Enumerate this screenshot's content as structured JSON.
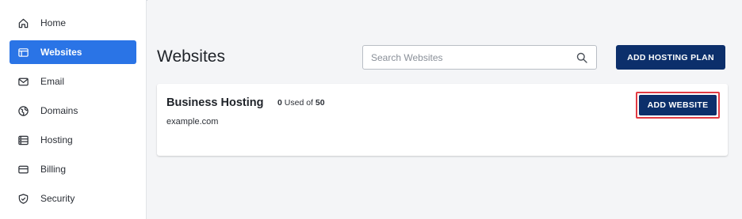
{
  "sidebar": {
    "items": [
      {
        "label": "Home",
        "icon": "home-icon",
        "active": false
      },
      {
        "label": "Websites",
        "icon": "browser-window-icon",
        "active": true
      },
      {
        "label": "Email",
        "icon": "envelope-icon",
        "active": false
      },
      {
        "label": "Domains",
        "icon": "globe-icon",
        "active": false
      },
      {
        "label": "Hosting",
        "icon": "server-icon",
        "active": false
      },
      {
        "label": "Billing",
        "icon": "credit-card-icon",
        "active": false
      },
      {
        "label": "Security",
        "icon": "shield-check-icon",
        "active": false
      }
    ]
  },
  "main": {
    "title": "Websites",
    "search": {
      "placeholder": "Search Websites"
    },
    "add_hosting_plan_label": "ADD HOSTING PLAN"
  },
  "card": {
    "title": "Business Hosting",
    "used_count": "0",
    "used_text": "Used of",
    "total": "50",
    "domain": "example.com",
    "add_website_label": "ADD WEBSITE"
  },
  "colors": {
    "accent_active": "#2a74e6",
    "primary_button": "#0c2f6b",
    "highlight_border": "#e23b43"
  }
}
